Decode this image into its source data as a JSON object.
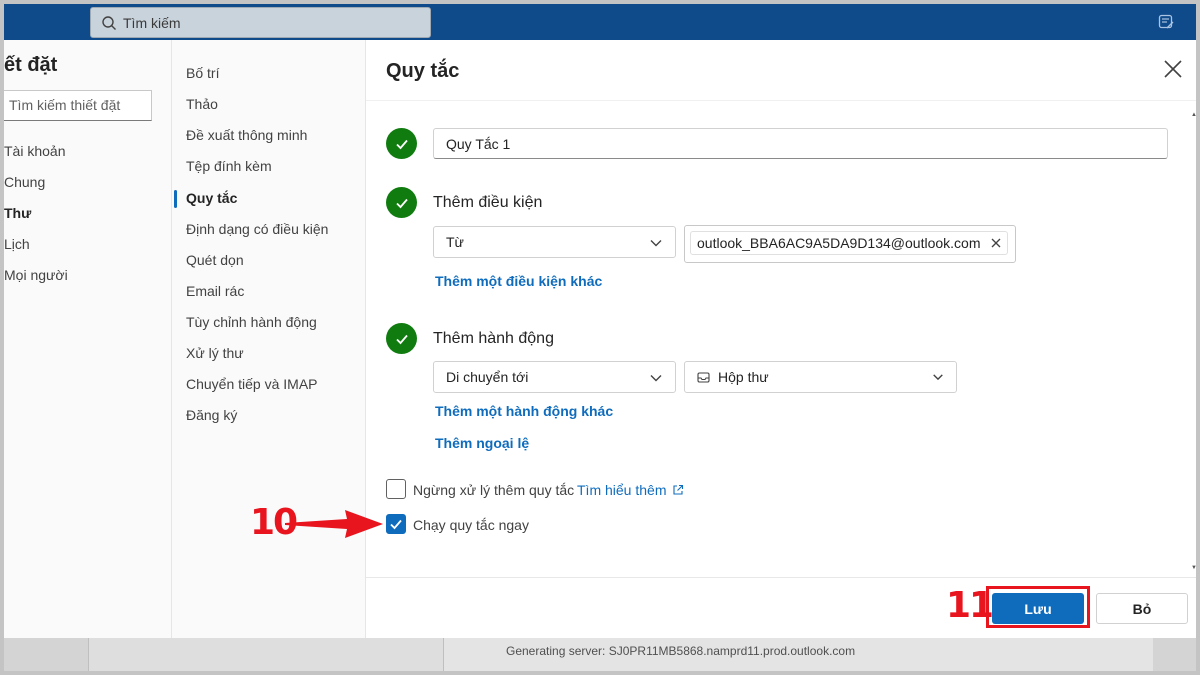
{
  "topbar": {
    "search_placeholder": "Tìm kiếm"
  },
  "settings": {
    "title": "ết đặt",
    "search_placeholder": "Tìm kiếm thiết đặt",
    "categories": [
      {
        "label": "Tài khoản",
        "active": false
      },
      {
        "label": "Chung",
        "active": false
      },
      {
        "label": "Thư",
        "active": true
      },
      {
        "label": "Lịch",
        "active": false
      },
      {
        "label": "Mọi người",
        "active": false
      }
    ],
    "subcategories": [
      {
        "label": "Bố trí",
        "active": false
      },
      {
        "label": "Thảo",
        "active": false
      },
      {
        "label": "Đề xuất thông minh",
        "active": false
      },
      {
        "label": "Tệp đính kèm",
        "active": false
      },
      {
        "label": "Quy tắc",
        "active": true
      },
      {
        "label": "Định dạng có điều kiện",
        "active": false
      },
      {
        "label": "Quét dọn",
        "active": false
      },
      {
        "label": "Email rác",
        "active": false
      },
      {
        "label": "Tùy chỉnh hành động",
        "active": false
      },
      {
        "label": "Xử lý thư",
        "active": false
      },
      {
        "label": "Chuyển tiếp và IMAP",
        "active": false
      },
      {
        "label": "Đăng ký",
        "active": false
      }
    ]
  },
  "rule": {
    "title": "Quy tắc",
    "name_value": "Quy Tắc 1",
    "condition": {
      "label": "Thêm điều kiện",
      "dropdown_value": "Từ",
      "tag_value": "outlook_BBA6AC9A5DA9D134@outlook.com",
      "add_link": "Thêm một điều kiện khác"
    },
    "action": {
      "label": "Thêm hành động",
      "dropdown_value": "Di chuyển tới",
      "folder_value": "Hộp thư",
      "add_link": "Thêm một hành động khác",
      "exception_link": "Thêm ngoại lệ"
    },
    "stop_processing": {
      "label": "Ngừng xử lý thêm quy tắc",
      "checked": false,
      "learn_more": "Tìm hiểu thêm"
    },
    "run_now": {
      "label": "Chạy quy tắc ngay",
      "checked": true
    },
    "save_label": "Lưu",
    "cancel_label": "Bỏ"
  },
  "background": {
    "status_text": "Generating server: SJ0PR11MB5868.namprd11.prod.outlook.com"
  },
  "annotations": {
    "step10": "10",
    "step11": "11"
  },
  "colors": {
    "accent": "#0f6cbd",
    "success": "#107c10",
    "annotation": "#e8141e",
    "topbar": "#0f4a8a"
  }
}
